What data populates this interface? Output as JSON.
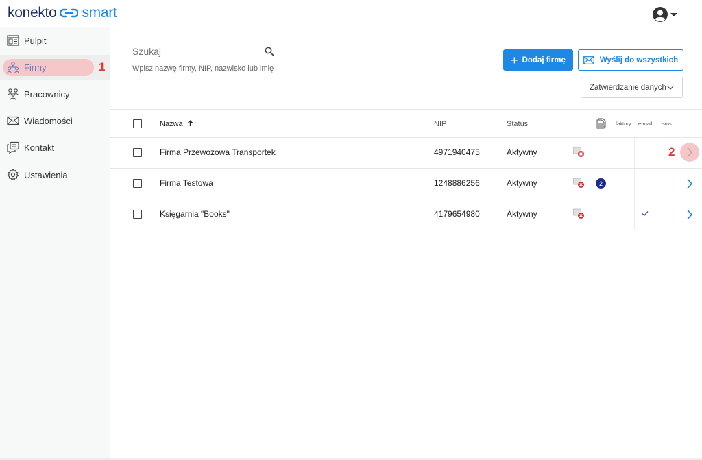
{
  "header": {
    "logo_brand": "konekto",
    "logo_product": "smart",
    "account_icon": "user-avatar-icon"
  },
  "sidebar": {
    "items": [
      {
        "label": "Pulpit",
        "icon": "dashboard-icon"
      },
      {
        "label": "Firmy",
        "icon": "companies-icon",
        "active": true,
        "step": "1"
      },
      {
        "label": "Pracownicy",
        "icon": "employees-icon"
      },
      {
        "label": "Wiadomości",
        "icon": "mail-icon"
      },
      {
        "label": "Kontakt",
        "icon": "contact-icon"
      },
      {
        "label": "Ustawienia",
        "icon": "gear-icon"
      }
    ]
  },
  "search": {
    "placeholder": "Szukaj",
    "hint": "Wpisz nazwę firmy, NIP, nazwisko lub imię"
  },
  "toolbar": {
    "add_label": "Dodaj firmę",
    "send_all_label": "Wyślij do wszystkich",
    "filter_selected": "Zatwierdzanie danych"
  },
  "table": {
    "columns": {
      "name": "Nazwa",
      "nip": "NIP",
      "status": "Status",
      "invoices": "faktury",
      "email": "e-mail",
      "sms": "sms"
    },
    "rows": [
      {
        "name": "Firma Przewozowa Transportek",
        "nip": "4971940475",
        "status": "Aktywny",
        "doc_count": "",
        "email_sent": false,
        "step": "2"
      },
      {
        "name": "Firma Testowa",
        "nip": "1248886256",
        "status": "Aktywny",
        "doc_count": "2",
        "email_sent": false
      },
      {
        "name": "Księgarnia \"Books\"",
        "nip": "4179654980",
        "status": "Aktywny",
        "doc_count": "",
        "email_sent": true
      }
    ]
  },
  "colors": {
    "accent": "#1e88e5",
    "highlight": "#f6c7c9",
    "step_number": "#e53935"
  }
}
